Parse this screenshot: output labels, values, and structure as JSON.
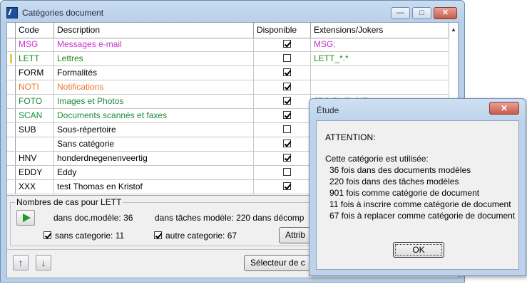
{
  "window": {
    "title": "Catégories document",
    "minimize_glyph": "—",
    "maximize_glyph": "□",
    "close_glyph": "✕"
  },
  "grid": {
    "columns": [
      "Code",
      "Description",
      "Disponible",
      "Extensions/Jokers"
    ],
    "rows": [
      {
        "code": "MSG",
        "description": "Messages e-mail",
        "disponible": true,
        "extensions": "MSG;",
        "color": "#c832c8",
        "current": false
      },
      {
        "code": "LETT",
        "description": "Lettres",
        "disponible": false,
        "extensions": "LETT_*.*",
        "color": "#1a8c1a",
        "current": true
      },
      {
        "code": "FORM",
        "description": "Formalités",
        "disponible": true,
        "extensions": "",
        "color": "#000000",
        "current": false
      },
      {
        "code": "NOTI",
        "description": "Notifications",
        "disponible": true,
        "extensions": "",
        "color": "#e8782a",
        "current": false
      },
      {
        "code": "FOTO",
        "description": "Images et Photos",
        "disponible": true,
        "extensions": "JPG;BMP;GIF",
        "color": "#1a8c3c",
        "current": false
      },
      {
        "code": "SCAN",
        "description": "Documents scannés et faxes",
        "disponible": true,
        "extensions": "",
        "color": "#1a8c3c",
        "current": false
      },
      {
        "code": "SUB",
        "description": "Sous-répertoire",
        "disponible": false,
        "extensions": "",
        "color": "#000000",
        "current": false
      },
      {
        "code": "",
        "description": "Sans catégorie",
        "disponible": true,
        "extensions": "",
        "color": "#000000",
        "current": false
      },
      {
        "code": "HNV",
        "description": "honderdnegenenveertig",
        "disponible": true,
        "extensions": "",
        "color": "#000000",
        "current": false
      },
      {
        "code": "EDDY",
        "description": "Eddy",
        "disponible": false,
        "extensions": "",
        "color": "#000000",
        "current": false
      },
      {
        "code": "XXX",
        "description": "test Thomas en Kristof",
        "disponible": true,
        "extensions": "",
        "color": "#000000",
        "current": false
      }
    ]
  },
  "panel": {
    "group_label": "Nombres de cas pour LETT",
    "stat_docmodele": "dans doc.modèle: 36",
    "stat_taches": "dans tâches modèle: 220 dans décomp",
    "sans_categorie": "sans categorie: 11",
    "autre_categorie": "autre categorie: 67",
    "attrib_button": "Attrib",
    "selecteur_button": "Sélecteur de c"
  },
  "dialog": {
    "title": "Étude",
    "close_glyph": "✕",
    "attention": "ATTENTION:",
    "intro": "Cette catégorie est utilisée:",
    "lines": [
      "36 fois dans des documents modèles",
      "220 fois dans des tâches modèles",
      "901 fois comme catégorie de document",
      "11 fois à inscrire comme catégorie de document",
      "67 fois à replacer comme catégorie de document"
    ],
    "ok": "OK"
  }
}
